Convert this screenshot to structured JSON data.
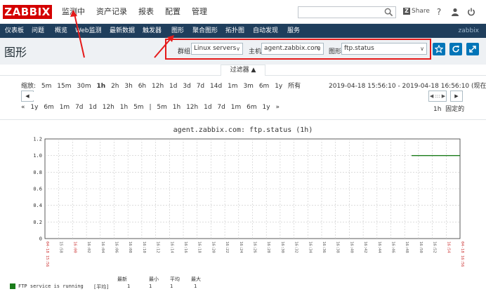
{
  "logo": "ZABBIX",
  "main_menu": [
    "监测中",
    "资产记录",
    "报表",
    "配置",
    "管理"
  ],
  "top_right": {
    "share": "Share",
    "help": "?",
    "user": "👤",
    "logout": "⏻"
  },
  "sub_menu": [
    "仪表板",
    "问题",
    "概览",
    "Web监测",
    "最新数据",
    "触发器",
    "图形",
    "聚合图形",
    "拓扑图",
    "自动发现",
    "服务"
  ],
  "sub_menu_right": "zabbix",
  "page_title": "图形",
  "controls": {
    "group_label": "群组",
    "group_value": "Linux servers",
    "host_label": "主机",
    "host_value": "agent.zabbix.com",
    "graph_label": "图形",
    "graph_value": "ftp.status"
  },
  "filter": {
    "tab_label": "过滤器 ▲",
    "zoom_label": "缩放:",
    "zoom_options": [
      "5m",
      "15m",
      "30m",
      "1h",
      "2h",
      "3h",
      "6h",
      "12h",
      "1d",
      "3d",
      "7d",
      "14d",
      "1m",
      "3m",
      "6m",
      "1y",
      "所有"
    ],
    "zoom_selected": "1h",
    "range": "2019-04-18 15:56:10 - 2019-04-18 16:56:10 (现在!)",
    "btn_left": "◀",
    "btn_right": "▶",
    "thumb": "◀ ::: ▶",
    "period_back": [
      "«",
      "1y",
      "6m",
      "1m",
      "7d",
      "1d",
      "12h",
      "1h",
      "5m"
    ],
    "period_sep": "|",
    "period_fwd": [
      "5m",
      "1h",
      "12h",
      "1d",
      "7d",
      "1m",
      "6m",
      "1y",
      "»"
    ],
    "period_value": "1h",
    "fixed_label": "固定的"
  },
  "graph": {
    "title": "agent.zabbix.com: ftp.status (1h)",
    "legend": {
      "headers": [
        "最新",
        "最小",
        "平均",
        "最大"
      ],
      "item": "FTP service is running",
      "func": "[平均]",
      "values": [
        "1",
        "1",
        "1",
        "1"
      ],
      "color": "#1A7C1A"
    }
  },
  "chart_data": {
    "type": "line",
    "title": "agent.zabbix.com: ftp.status (1h)",
    "ylim": [
      0,
      1.2
    ],
    "yticks": [
      "0",
      "0.2",
      "0.4",
      "0.6",
      "0.8",
      "1.0",
      "1.2"
    ],
    "xticks": [
      "04-18 15:56",
      "15:58",
      "16:00",
      "16:02",
      "16:04",
      "16:06",
      "16:08",
      "16:10",
      "16:12",
      "16:14",
      "16:16",
      "16:18",
      "16:20",
      "16:22",
      "16:24",
      "16:26",
      "16:28",
      "16:30",
      "16:32",
      "16:34",
      "16:36",
      "16:38",
      "16:40",
      "16:42",
      "16:44",
      "16:46",
      "16:48",
      "16:50",
      "16:52",
      "16:54",
      "04-18 16:56"
    ],
    "series": [
      {
        "name": "FTP service is running",
        "color": "#1A7C1A",
        "x_start": "16:49",
        "x_end": "16:56",
        "value": 1.0
      }
    ]
  }
}
